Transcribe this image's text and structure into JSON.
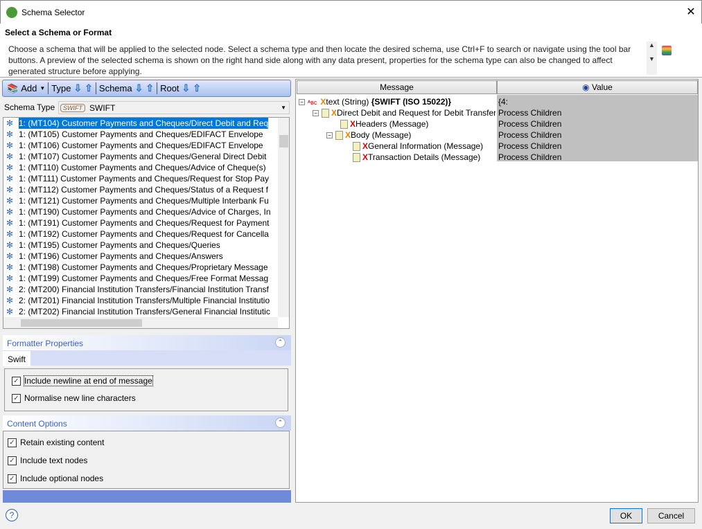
{
  "window": {
    "title": "Schema Selector",
    "close": "✕"
  },
  "header": {
    "title": "Select a Schema or Format",
    "description": "Choose a schema that will be applied to the selected node. Select a schema type and then locate the desired schema, use Ctrl+F to search or navigate using the tool bar buttons. A preview of the selected schema is shown on the right hand side along with any data present, properties for the schema type can also be changed to affect generated structure before applying."
  },
  "toolbar": {
    "add": "Add",
    "type": "Type",
    "schema": "Schema",
    "root": "Root"
  },
  "schema_type": {
    "label": "Schema Type",
    "logo": "SWIFT",
    "value": "SWIFT"
  },
  "schemas": [
    "1: (MT104)  Customer Payments and Cheques/Direct Debit and Req",
    "1: (MT105)  Customer Payments and Cheques/EDIFACT Envelope",
    "1: (MT106)  Customer Payments and Cheques/EDIFACT Envelope",
    "1: (MT107)  Customer Payments and Cheques/General Direct Debit",
    "1: (MT110)  Customer Payments and Cheques/Advice of Cheque(s)",
    "1: (MT111)  Customer Payments and Cheques/Request for Stop Pay",
    "1: (MT112)  Customer Payments and Cheques/Status of a Request f",
    "1: (MT121)  Customer Payments and Cheques/Multiple Interbank Fu",
    "1: (MT190)  Customer Payments and Cheques/Advice of Charges, In",
    "1: (MT191)  Customer Payments and Cheques/Request for Payment",
    "1: (MT192)  Customer Payments and Cheques/Request for Cancella",
    "1: (MT195)  Customer Payments and Cheques/Queries",
    "1: (MT196)  Customer Payments and Cheques/Answers",
    "1: (MT198)  Customer Payments and Cheques/Proprietary Message",
    "1: (MT199)  Customer Payments and Cheques/Free Format Messag",
    "2: (MT200)  Financial Institution Transfers/Financial Institution Transf",
    "2: (MT201)  Financial Institution Transfers/Multiple Financial Institutio",
    "2: (MT202)  Financial Institution Transfers/General Financial Institutic"
  ],
  "formatter": {
    "title": "Formatter Properties",
    "tab": "Swift",
    "options": [
      {
        "label": "Include newline at end of message",
        "checked": true
      },
      {
        "label": "Normalise new line characters",
        "checked": true
      }
    ]
  },
  "content": {
    "title": "Content Options",
    "options": [
      {
        "label": "Retain existing content",
        "checked": true
      },
      {
        "label": "Include text nodes",
        "checked": true
      },
      {
        "label": "Include optional nodes",
        "checked": true
      }
    ]
  },
  "preview": {
    "col_message": "Message",
    "col_value": "Value",
    "rows": [
      {
        "x": "X",
        "xcolor": "orange",
        "name": "text (String) ",
        "bold": "{SWIFT (ISO 15022)}",
        "value": "{4:"
      },
      {
        "x": "X",
        "xcolor": "orange",
        "name": "Direct Debit and Request for Debit Transfer",
        "bold": "",
        "value": "Process Children"
      },
      {
        "x": "X",
        "xcolor": "red",
        "name": "Headers (Message)",
        "bold": "",
        "value": "Process Children"
      },
      {
        "x": "X",
        "xcolor": "orange",
        "name": "Body (Message)",
        "bold": "",
        "value": "Process Children"
      },
      {
        "x": "X",
        "xcolor": "red",
        "name": "General Information (Message)",
        "bold": "",
        "value": "Process Children"
      },
      {
        "x": "X",
        "xcolor": "red",
        "name": "Transaction Details (Message)",
        "bold": "",
        "value": "Process Children"
      }
    ]
  },
  "buttons": {
    "help": "?",
    "ok": "OK",
    "cancel": "Cancel"
  }
}
